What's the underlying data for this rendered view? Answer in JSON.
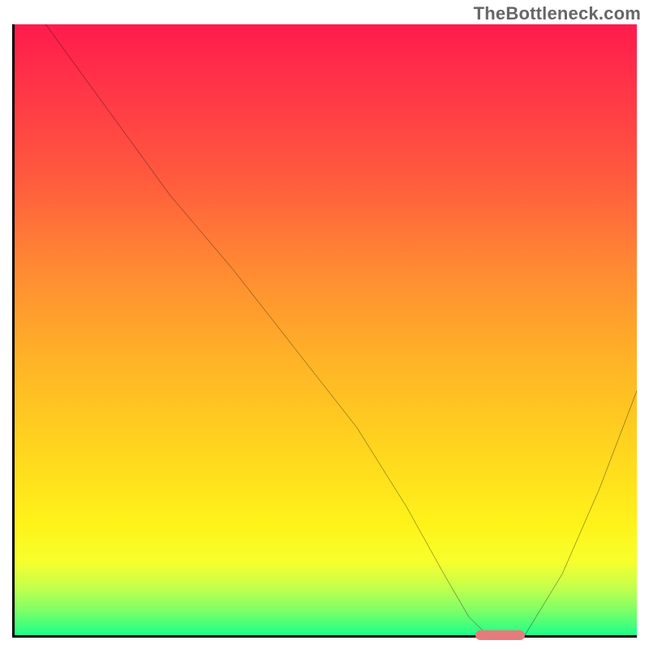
{
  "watermark": "TheBottleneck.com",
  "chart_data": {
    "type": "line",
    "title": "",
    "xlabel": "",
    "ylabel": "",
    "xlim": [
      0,
      100
    ],
    "ylim": [
      0,
      100
    ],
    "grid": false,
    "legend": false,
    "series": [
      {
        "name": "curve",
        "x": [
          5,
          15,
          25,
          35,
          45,
          55,
          63,
          69,
          73,
          76,
          82,
          88,
          94,
          100
        ],
        "y": [
          100,
          86,
          72,
          60,
          47,
          34,
          21,
          10,
          3,
          0,
          0,
          10,
          24,
          40
        ]
      }
    ],
    "annotations": {
      "optimum_marker": {
        "x_start": 74,
        "x_end": 82,
        "y": 0,
        "color": "#e77b7b"
      }
    },
    "background_gradient": [
      "#ff1b4c",
      "#ff8a33",
      "#ffd61e",
      "#fff31a",
      "#1dff8a"
    ]
  },
  "colors": {
    "curve": "#000000",
    "axis": "#000000",
    "marker": "#e77b7b",
    "watermark": "#666666"
  }
}
